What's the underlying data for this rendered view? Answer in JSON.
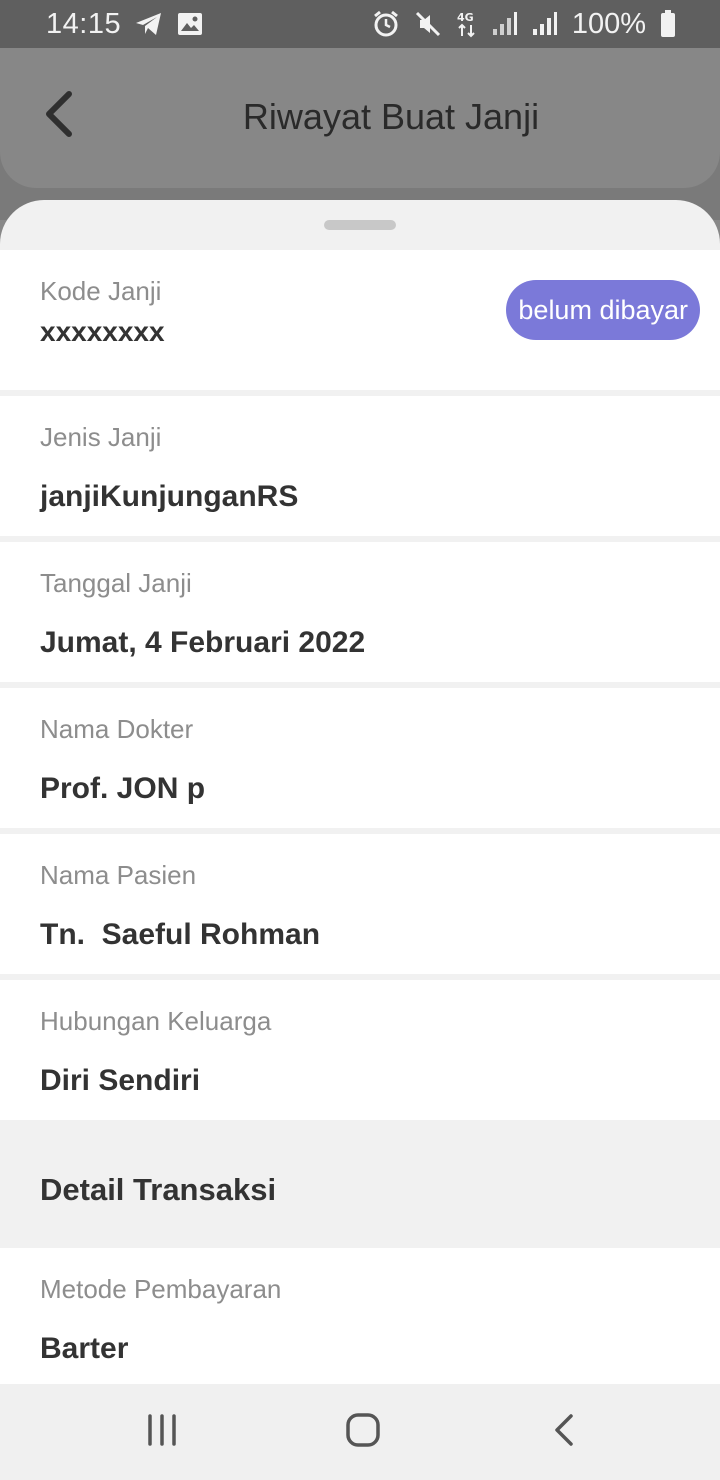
{
  "status_bar": {
    "time": "14:15",
    "battery_pct": "100%",
    "icons_left": [
      "telegram-icon",
      "gallery-icon"
    ],
    "icons_right": [
      "alarm-icon",
      "mute-icon",
      "4g-icon",
      "signal-icon",
      "signal-icon",
      "battery-icon"
    ]
  },
  "header": {
    "title": "Riwayat Buat Janji"
  },
  "appointment": {
    "code_label": "Kode Janji",
    "code_value": "xxxxxxxx",
    "status_badge": "belum dibayar",
    "type_label": "Jenis Janji",
    "type_value": "janjiKunjunganRS",
    "date_label": "Tanggal Janji",
    "date_value": "Jumat, 4 Februari 2022",
    "doctor_label": "Nama Dokter",
    "doctor_value": "Prof. JON p",
    "patient_label": "Nama Pasien",
    "patient_value": "Tn.  Saeful Rohman",
    "relation_label": "Hubungan Keluarga",
    "relation_value": "Diri Sendiri"
  },
  "transaction": {
    "section_title": "Detail Transaksi",
    "payment_label": "Metode Pembayaran",
    "payment_value": "Barter"
  },
  "colors": {
    "badge": "#7b79d9",
    "overlay": "#888888"
  },
  "nav_bar": {
    "icons": [
      "recent-apps-icon",
      "home-icon",
      "back-icon"
    ]
  }
}
